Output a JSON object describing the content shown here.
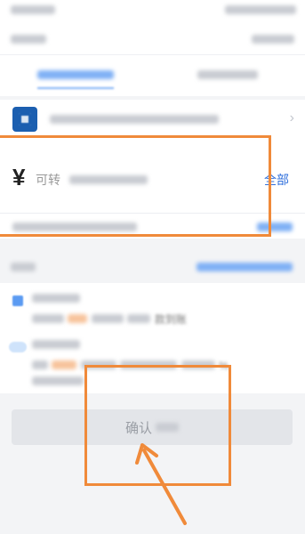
{
  "amount": {
    "currency_symbol": "¥",
    "placeholder_label": "可转",
    "all_label": "全部"
  },
  "confirm": {
    "label": "确认"
  },
  "icons": {
    "bank_logo": "bank-logo-icon",
    "chevron": "chevron-right-icon",
    "arrow": "annotation-arrow-icon"
  },
  "colors": {
    "annotation": "#f08a3a",
    "link": "#2f6fdc",
    "button_bg": "#e3e5e9",
    "bank_brand": "#1c5fb0"
  },
  "notes": {
    "fragment_1": "款到账",
    "fragment_2": "%"
  }
}
